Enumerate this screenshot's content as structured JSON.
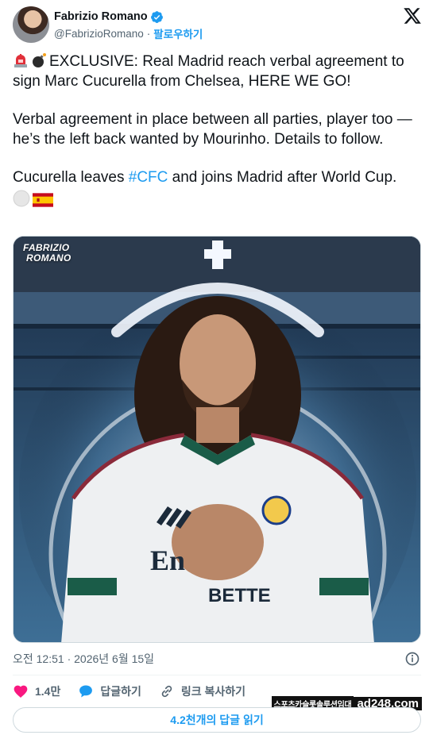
{
  "author": {
    "display_name": "Fabrizio Romano",
    "handle": "@FabrizioRomano",
    "separator": "·",
    "follow_label": "팔로우하기",
    "verified_color": "#1d9bf0"
  },
  "tweet": {
    "paragraphs": [
      "EXCLUSIVE: Real Madrid reach verbal agreement to sign Marc Cucurella from Chelsea, HERE WE GO!",
      "Verbal agreement in place between all parties, player too — he’s the left back wanted by Mourinho. Details to follow.",
      "Cucurella leaves ",
      " and joins Madrid after World Cup."
    ],
    "hashtag": "#CFC",
    "leading_emojis": [
      "siren-emoji",
      "bomb-emoji"
    ],
    "trailing_emojis": [
      "white-circle-emoji",
      "spain-flag-emoji"
    ]
  },
  "media": {
    "watermark_line1": "FABRIZIO",
    "watermark_line2": "ROMANO"
  },
  "meta": {
    "timestamp": "오전 12:51 · 2026년 6월 15일"
  },
  "actions": {
    "like_count": "1.4만",
    "reply_label": "답글하기",
    "copy_link_label": "링크 복사하기"
  },
  "ad": {
    "left_text": "스포츠카슬롯솔루션임대",
    "right_text": "ad248.com"
  },
  "read_replies_label": "4.2천개의 답글 읽기",
  "colors": {
    "accent": "#1d9bf0",
    "text": "#0f1419",
    "muted": "#536471",
    "like": "#f91880"
  }
}
